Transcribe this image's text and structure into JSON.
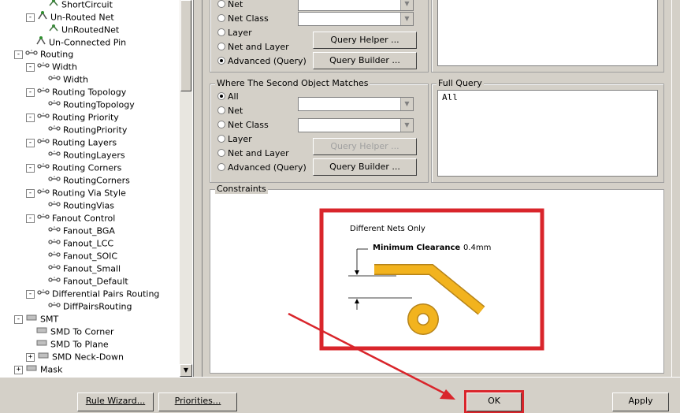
{
  "tree": {
    "items": [
      {
        "label": "ShortCircuit",
        "level": 3,
        "icon": "rule",
        "exp": ""
      },
      {
        "label": "Un-Routed Net",
        "level": 2,
        "icon": "rule-cat",
        "exp": "-"
      },
      {
        "label": "UnRoutedNet",
        "level": 3,
        "icon": "rule",
        "exp": ""
      },
      {
        "label": "Un-Connected Pin",
        "level": 2,
        "icon": "rule-cat",
        "exp": ""
      },
      {
        "label": "Routing",
        "level": 1,
        "icon": "routing",
        "exp": "-"
      },
      {
        "label": "Width",
        "level": 2,
        "icon": "routing",
        "exp": "-"
      },
      {
        "label": "Width",
        "level": 3,
        "icon": "routing",
        "exp": ""
      },
      {
        "label": "Routing Topology",
        "level": 2,
        "icon": "routing",
        "exp": "-"
      },
      {
        "label": "RoutingTopology",
        "level": 3,
        "icon": "routing",
        "exp": ""
      },
      {
        "label": "Routing Priority",
        "level": 2,
        "icon": "routing",
        "exp": "-"
      },
      {
        "label": "RoutingPriority",
        "level": 3,
        "icon": "routing",
        "exp": ""
      },
      {
        "label": "Routing Layers",
        "level": 2,
        "icon": "routing",
        "exp": "-"
      },
      {
        "label": "RoutingLayers",
        "level": 3,
        "icon": "routing",
        "exp": ""
      },
      {
        "label": "Routing Corners",
        "level": 2,
        "icon": "routing",
        "exp": "-"
      },
      {
        "label": "RoutingCorners",
        "level": 3,
        "icon": "routing",
        "exp": ""
      },
      {
        "label": "Routing Via Style",
        "level": 2,
        "icon": "routing",
        "exp": "-"
      },
      {
        "label": "RoutingVias",
        "level": 3,
        "icon": "routing",
        "exp": ""
      },
      {
        "label": "Fanout Control",
        "level": 2,
        "icon": "routing",
        "exp": "-"
      },
      {
        "label": "Fanout_BGA",
        "level": 3,
        "icon": "routing",
        "exp": ""
      },
      {
        "label": "Fanout_LCC",
        "level": 3,
        "icon": "routing",
        "exp": ""
      },
      {
        "label": "Fanout_SOIC",
        "level": 3,
        "icon": "routing",
        "exp": ""
      },
      {
        "label": "Fanout_Small",
        "level": 3,
        "icon": "routing",
        "exp": ""
      },
      {
        "label": "Fanout_Default",
        "level": 3,
        "icon": "routing",
        "exp": ""
      },
      {
        "label": "Differential Pairs Routing",
        "level": 2,
        "icon": "routing",
        "exp": "-"
      },
      {
        "label": "DiffPairsRouting",
        "level": 3,
        "icon": "routing",
        "exp": ""
      },
      {
        "label": "SMT",
        "level": 1,
        "icon": "smt",
        "exp": "-"
      },
      {
        "label": "SMD To Corner",
        "level": 2,
        "icon": "smt",
        "exp": ""
      },
      {
        "label": "SMD To Plane",
        "level": 2,
        "icon": "smt",
        "exp": ""
      },
      {
        "label": "SMD Neck-Down",
        "level": 2,
        "icon": "smt",
        "exp": "+"
      },
      {
        "label": "Mask",
        "level": 1,
        "icon": "smt",
        "exp": "+"
      }
    ]
  },
  "first_match": {
    "options": [
      "Net",
      "Net Class",
      "Layer",
      "Net and Layer",
      "Advanced (Query)"
    ],
    "selected": 4,
    "query_helper": "Query Helper ...",
    "query_builder": "Query Builder ..."
  },
  "second_match": {
    "title": "Where The Second Object Matches",
    "options": [
      "All",
      "Net",
      "Net Class",
      "Layer",
      "Net and Layer",
      "Advanced (Query)"
    ],
    "selected": 0,
    "query_helper": "Query Helper ...",
    "query_builder": "Query Builder ..."
  },
  "full_query": {
    "title": "Full Query",
    "value": "All"
  },
  "constraints": {
    "title": "Constraints",
    "note": "Different Nets Only",
    "clearance_label": "Minimum Clearance",
    "clearance_value": "0.4mm"
  },
  "buttons": {
    "rule_wizard": "Rule Wizard...",
    "priorities": "Priorities...",
    "ok": "OK",
    "apply": "Apply"
  },
  "colors": {
    "highlight": "#d9252b",
    "copper": "#f2b31e",
    "copper_edge": "#b5831a"
  }
}
